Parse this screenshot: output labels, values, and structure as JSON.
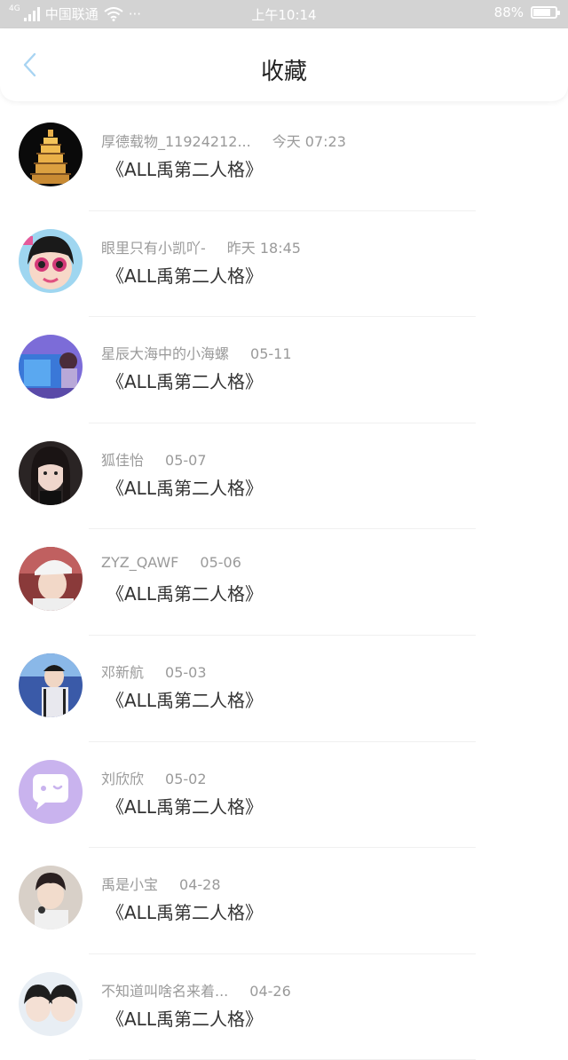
{
  "status_bar": {
    "network": "4G",
    "carrier": "中国联通",
    "more": "···",
    "time": "上午10:14",
    "battery_percent": "88%",
    "battery_level": 0.88
  },
  "nav": {
    "back_icon": "chevron-left-icon",
    "title": "收藏"
  },
  "items": [
    {
      "name": "厚德载物_11924212...",
      "time": "今天 07:23",
      "message": "《ALL禹第二人格》",
      "avatar": "pagoda-avatar"
    },
    {
      "name": "眼里只有小凯吖-",
      "time": "昨天 18:45",
      "message": "《ALL禹第二人格》",
      "avatar": "cartoon-girl-avatar"
    },
    {
      "name": "星辰大海中的小海螺",
      "time": "05-11",
      "message": "《ALL禹第二人格》",
      "avatar": "blue-scene-avatar"
    },
    {
      "name": "狐佳怡",
      "time": "05-07",
      "message": "《ALL禹第二人格》",
      "avatar": "girl-photo-avatar"
    },
    {
      "name": "ZYZ_QAWF",
      "time": "05-06",
      "message": "《ALL禹第二人格》",
      "avatar": "boy-cap-avatar"
    },
    {
      "name": "邓新航",
      "time": "05-03",
      "message": "《ALL禹第二人格》",
      "avatar": "boy-stage-avatar"
    },
    {
      "name": "刘欣欣",
      "time": "05-02",
      "message": "《ALL禹第二人格》",
      "avatar": "default-chat-avatar"
    },
    {
      "name": "禹是小宝",
      "time": "04-28",
      "message": "《ALL禹第二人格》",
      "avatar": "boy-mic-avatar"
    },
    {
      "name": "不知道叫啥名来着...",
      "time": "04-26",
      "message": "《ALL禹第二人格》",
      "avatar": "two-boys-avatar"
    }
  ],
  "colors": {
    "status_bar_bg": "#d3d3d3",
    "back_icon": "#a8d4f2",
    "default_avatar_bg": "#c9b3ee"
  }
}
